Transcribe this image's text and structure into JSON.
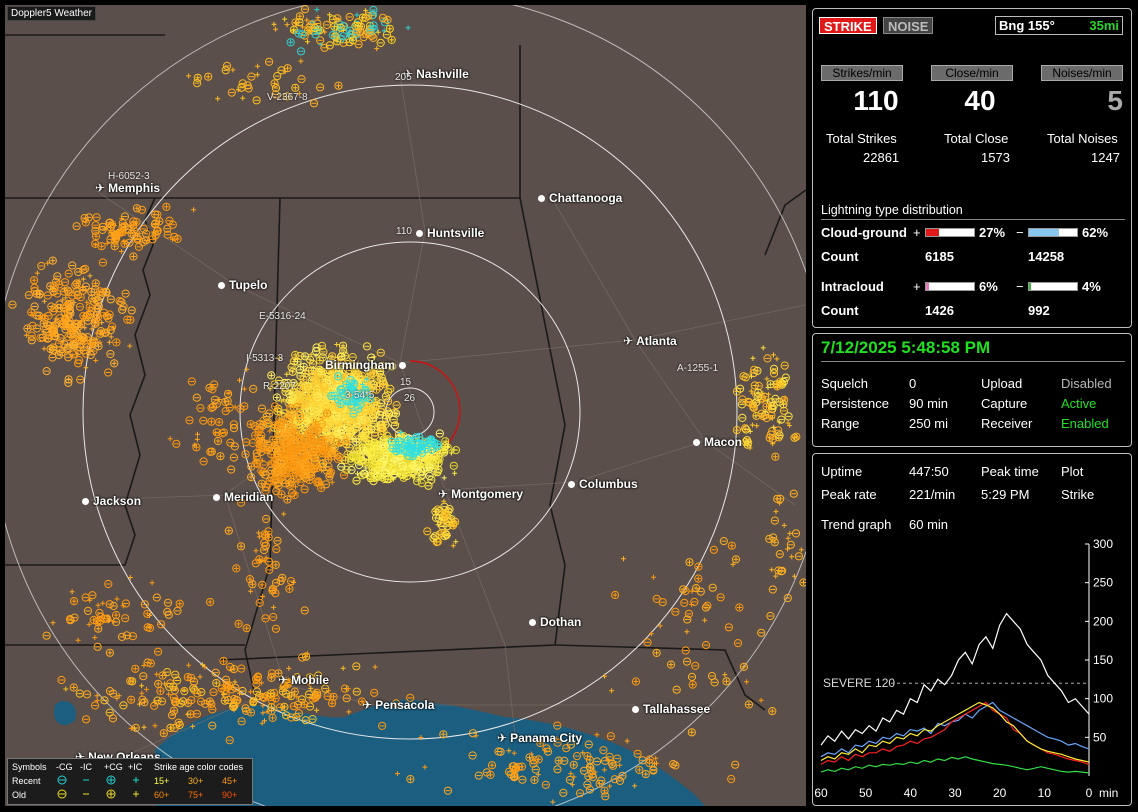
{
  "brand": "Doppler5 Weather",
  "cities": [
    {
      "name": "Nashville",
      "icon": "plane"
    },
    {
      "name": "Memphis",
      "icon": "plane"
    },
    {
      "name": "Chattanooga",
      "icon": "dot"
    },
    {
      "name": "Huntsville",
      "icon": "dot"
    },
    {
      "name": "Tupelo",
      "icon": "dot"
    },
    {
      "name": "Birmingham",
      "icon": "dot"
    },
    {
      "name": "Atlanta",
      "icon": "plane"
    },
    {
      "name": "Macon",
      "icon": "dot"
    },
    {
      "name": "Columbus",
      "icon": "dot"
    },
    {
      "name": "Montgomery",
      "icon": "plane"
    },
    {
      "name": "Jackson",
      "icon": "dot"
    },
    {
      "name": "Meridian",
      "icon": "dot"
    },
    {
      "name": "Dothan",
      "icon": "dot"
    },
    {
      "name": "Mobile",
      "icon": "plane"
    },
    {
      "name": "Pensacola",
      "icon": "plane"
    },
    {
      "name": "Tallahassee",
      "icon": "dot"
    },
    {
      "name": "Panama City",
      "icon": "plane"
    },
    {
      "name": "New Orleans",
      "icon": "plane"
    }
  ],
  "range_labels": [
    "205",
    "110",
    "15",
    "26"
  ],
  "map_annotations": [
    "V-2367-8",
    "H-6052-3",
    "E-5316-24",
    "I-5313-3",
    "R-2207",
    "A-1255-1",
    "3-54*5"
  ],
  "legend": {
    "header": [
      "Symbols",
      "-CG",
      "-IC",
      "+CG",
      "+IC",
      "Strike age color codes"
    ],
    "recent": {
      "label": "Recent",
      "ages": [
        "15+",
        "30+",
        "45+"
      ]
    },
    "old": {
      "label": "Old",
      "ages": [
        "60+",
        "75+",
        "90+"
      ]
    }
  },
  "top": {
    "strike_label": "STRIKE",
    "noise_label": "NOISE",
    "bearing": "Bng 155°",
    "distance": "35mi"
  },
  "rates": {
    "headers": [
      "Strikes/min",
      "Close/min",
      "Noises/min"
    ],
    "values": [
      "110",
      "40",
      "5"
    ],
    "total_labels": [
      "Total Strikes",
      "Total Close",
      "Total Noises"
    ],
    "totals": [
      "22861",
      "1573",
      "1247"
    ]
  },
  "distribution": {
    "title": "Lightning type distribution",
    "cg_label": "Cloud-ground",
    "ic_label": "Intracloud",
    "count_label": "Count",
    "plus": "+",
    "minus": "−",
    "cg_pos_pct": "27%",
    "cg_neg_pct": "62%",
    "cg_pos_count": "6185",
    "cg_neg_count": "14258",
    "ic_pos_pct": "6%",
    "ic_neg_pct": "4%",
    "ic_pos_count": "1426",
    "ic_neg_count": "992",
    "cg_pos_fill": 0.27,
    "cg_neg_fill": 0.62,
    "ic_pos_fill": 0.06,
    "ic_neg_fill": 0.04
  },
  "status": {
    "datetime": "7/12/2025 5:48:58 PM",
    "rows": [
      [
        "Squelch",
        "0",
        "Upload",
        "Disabled"
      ],
      [
        "Persistence",
        "90 min",
        "Capture",
        "Active"
      ],
      [
        "Range",
        "250 mi",
        "Receiver",
        "Enabled"
      ]
    ]
  },
  "stats": {
    "uptime_label": "Uptime",
    "uptime": "447:50",
    "peak_time_label": "Peak time",
    "plot_label": "Plot",
    "peak_rate_label": "Peak rate",
    "peak_rate": "221/min",
    "peak_time": "5:29 PM",
    "plot": "Strike",
    "trend_label": "Trend graph",
    "trend": "60 min"
  },
  "chart_data": {
    "type": "line",
    "x_label": "min",
    "x_ticks": [
      "60",
      "50",
      "40",
      "30",
      "20",
      "10",
      "0"
    ],
    "y_ticks": [
      "50",
      "100",
      "150",
      "200",
      "250",
      "300"
    ],
    "ylim": [
      0,
      300
    ],
    "xlim": [
      60,
      0
    ],
    "severe_label": "SEVERE 120",
    "severe_value": 120,
    "series": [
      {
        "color": "#ffffff",
        "values": [
          40,
          52,
          45,
          58,
          48,
          60,
          55,
          65,
          58,
          75,
          70,
          85,
          80,
          100,
          95,
          118,
          110,
          125,
          118,
          130,
          150,
          160,
          145,
          170,
          180,
          165,
          195,
          210,
          200,
          190,
          170,
          160,
          150,
          130,
          120,
          110,
          95,
          100,
          90,
          80
        ]
      },
      {
        "color": "#6aa7ff",
        "values": [
          25,
          30,
          28,
          35,
          30,
          40,
          38,
          45,
          42,
          50,
          48,
          55,
          52,
          60,
          58,
          62,
          55,
          68,
          65,
          70,
          72,
          80,
          75,
          85,
          90,
          95,
          85,
          80,
          75,
          70,
          65,
          60,
          55,
          50,
          48,
          45,
          40,
          42,
          38,
          35
        ]
      },
      {
        "color": "#ff2020",
        "values": [
          15,
          20,
          18,
          25,
          20,
          28,
          25,
          30,
          30,
          35,
          32,
          38,
          40,
          45,
          42,
          48,
          50,
          55,
          60,
          70,
          75,
          80,
          85,
          90,
          95,
          85,
          80,
          75,
          60,
          55,
          45,
          40,
          35,
          30,
          28,
          25,
          22,
          20,
          18,
          15
        ]
      },
      {
        "color": "#ffee33",
        "values": [
          20,
          25,
          22,
          30,
          28,
          35,
          30,
          40,
          38,
          45,
          42,
          50,
          48,
          55,
          52,
          60,
          58,
          65,
          70,
          75,
          80,
          85,
          90,
          95,
          92,
          88,
          80,
          70,
          65,
          55,
          45,
          40,
          35,
          32,
          30,
          28,
          25,
          22,
          20,
          18
        ]
      },
      {
        "color": "#33dd44",
        "values": [
          5,
          8,
          6,
          10,
          8,
          12,
          10,
          14,
          12,
          15,
          14,
          16,
          15,
          18,
          16,
          20,
          18,
          22,
          20,
          24,
          22,
          25,
          22,
          20,
          18,
          16,
          15,
          14,
          12,
          10,
          8,
          10,
          12,
          10,
          8,
          6,
          5,
          6,
          5,
          4
        ]
      }
    ]
  }
}
